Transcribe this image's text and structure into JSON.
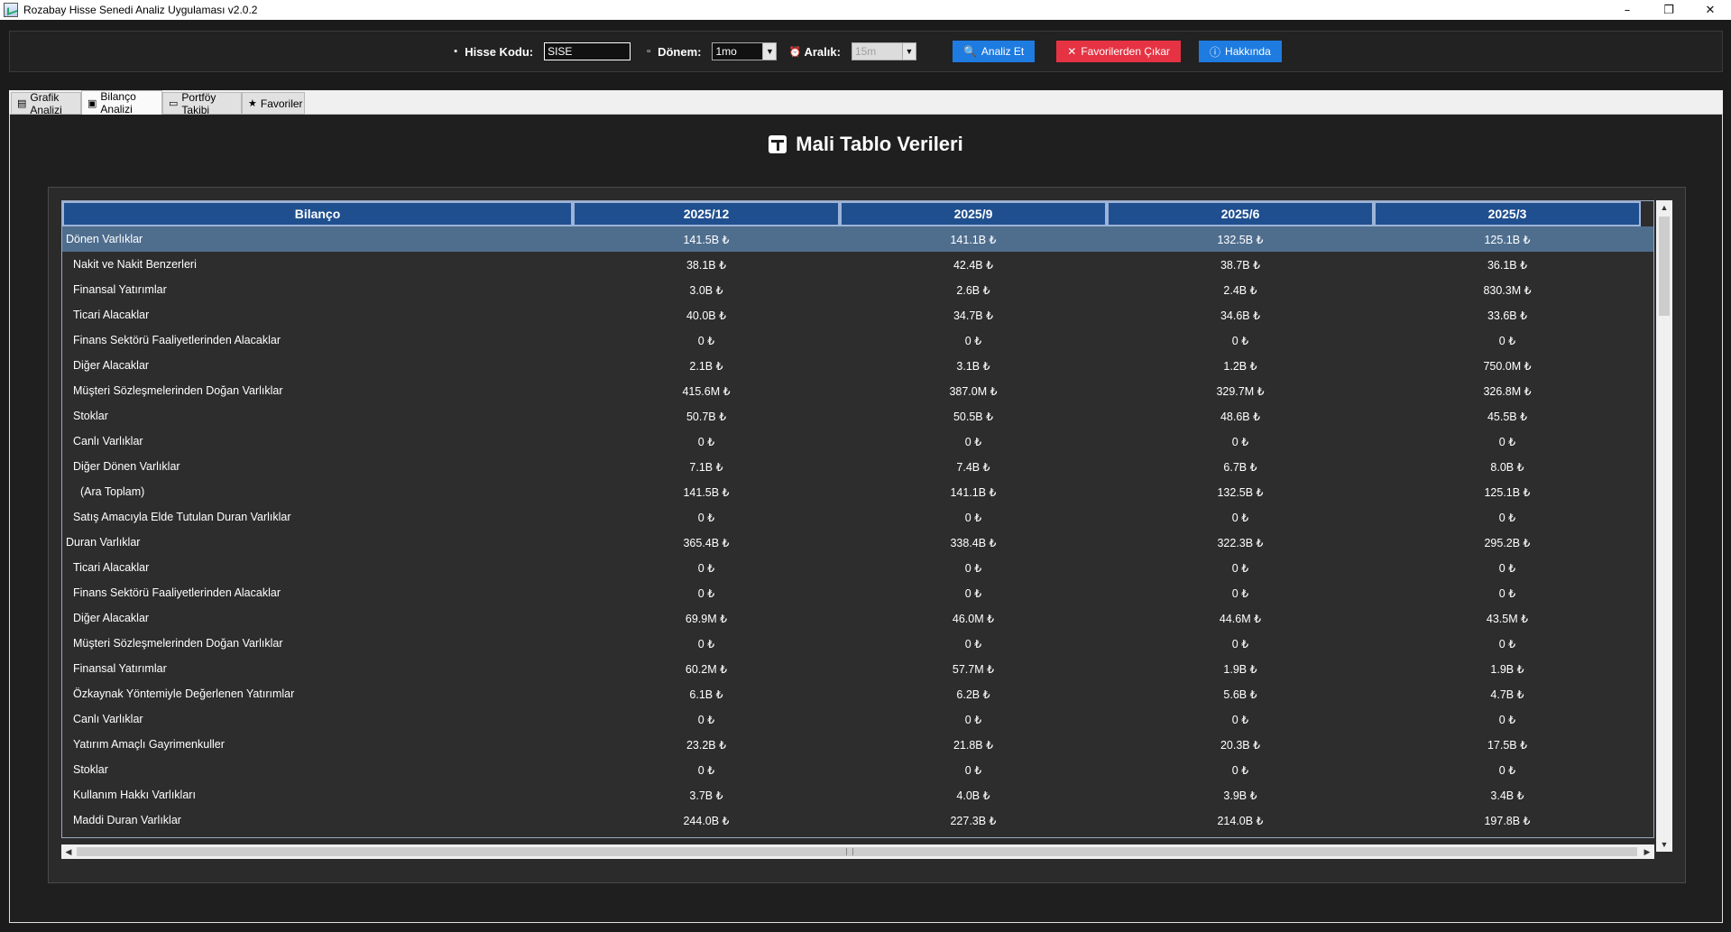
{
  "window": {
    "title": "Rozabay Hisse Senedi Analiz Uygulaması v2.0.2",
    "controls": {
      "minimize": "–",
      "maximize": "❐",
      "close": "✕"
    }
  },
  "toolbar": {
    "symbol_label": "Hisse Kodu:",
    "symbol_value": "SISE",
    "period_label": "Dönem:",
    "period_value": "1mo",
    "interval_label": "Aralık:",
    "interval_value": "15m",
    "analyze_label": "Analiz Et",
    "remove_fav_label": "Favorilerden Çıkar",
    "about_label": "Hakkında"
  },
  "tabs": [
    {
      "label": "Grafik Analizi",
      "active": false
    },
    {
      "label": "Bilanço Analizi",
      "active": true
    },
    {
      "label": "Portföy Takibi",
      "active": false
    },
    {
      "label": "Favoriler",
      "active": false
    }
  ],
  "page": {
    "title": "Mali Tablo Verileri"
  },
  "table": {
    "headers": [
      "Bilanço",
      "2025/12",
      "2025/9",
      "2025/6",
      "2025/3"
    ],
    "rows": [
      {
        "label": "Dönen Varlıklar",
        "level": 0,
        "selected": true,
        "values": [
          "141.5B ₺",
          "141.1B ₺",
          "132.5B ₺",
          "125.1B ₺"
        ]
      },
      {
        "label": "Nakit ve Nakit Benzerleri",
        "level": 1,
        "values": [
          "38.1B ₺",
          "42.4B ₺",
          "38.7B ₺",
          "36.1B ₺"
        ]
      },
      {
        "label": "Finansal Yatırımlar",
        "level": 1,
        "values": [
          "3.0B ₺",
          "2.6B ₺",
          "2.4B ₺",
          "830.3M ₺"
        ]
      },
      {
        "label": "Ticari Alacaklar",
        "level": 1,
        "values": [
          "40.0B ₺",
          "34.7B ₺",
          "34.6B ₺",
          "33.6B ₺"
        ]
      },
      {
        "label": "Finans Sektörü Faaliyetlerinden Alacaklar",
        "level": 1,
        "values": [
          "0 ₺",
          "0 ₺",
          "0 ₺",
          "0 ₺"
        ]
      },
      {
        "label": "Diğer Alacaklar",
        "level": 1,
        "values": [
          "2.1B ₺",
          "3.1B ₺",
          "1.2B ₺",
          "750.0M ₺"
        ]
      },
      {
        "label": "Müşteri Sözleşmelerinden Doğan Varlıklar",
        "level": 1,
        "values": [
          "415.6M ₺",
          "387.0M ₺",
          "329.7M ₺",
          "326.8M ₺"
        ]
      },
      {
        "label": "Stoklar",
        "level": 1,
        "values": [
          "50.7B ₺",
          "50.5B ₺",
          "48.6B ₺",
          "45.5B ₺"
        ]
      },
      {
        "label": "Canlı Varlıklar",
        "level": 1,
        "values": [
          "0 ₺",
          "0 ₺",
          "0 ₺",
          "0 ₺"
        ]
      },
      {
        "label": "Diğer Dönen Varlıklar",
        "level": 1,
        "values": [
          "7.1B ₺",
          "7.4B ₺",
          "6.7B ₺",
          "8.0B ₺"
        ]
      },
      {
        "label": "(Ara Toplam)",
        "level": 2,
        "values": [
          "141.5B ₺",
          "141.1B ₺",
          "132.5B ₺",
          "125.1B ₺"
        ]
      },
      {
        "label": "Satış Amacıyla Elde Tutulan Duran Varlıklar",
        "level": 1,
        "values": [
          "0 ₺",
          "0 ₺",
          "0 ₺",
          "0 ₺"
        ]
      },
      {
        "label": "Duran Varlıklar",
        "level": 0,
        "values": [
          "365.4B ₺",
          "338.4B ₺",
          "322.3B ₺",
          "295.2B ₺"
        ]
      },
      {
        "label": "Ticari Alacaklar",
        "level": 1,
        "values": [
          "0 ₺",
          "0 ₺",
          "0 ₺",
          "0 ₺"
        ]
      },
      {
        "label": "Finans Sektörü Faaliyetlerinden Alacaklar",
        "level": 1,
        "values": [
          "0 ₺",
          "0 ₺",
          "0 ₺",
          "0 ₺"
        ]
      },
      {
        "label": "Diğer Alacaklar",
        "level": 1,
        "values": [
          "69.9M ₺",
          "46.0M ₺",
          "44.6M ₺",
          "43.5M ₺"
        ]
      },
      {
        "label": "Müşteri Sözleşmelerinden Doğan Varlıklar",
        "level": 1,
        "values": [
          "0 ₺",
          "0 ₺",
          "0 ₺",
          "0 ₺"
        ]
      },
      {
        "label": "Finansal Yatırımlar",
        "level": 1,
        "values": [
          "60.2M ₺",
          "57.7M ₺",
          "1.9B ₺",
          "1.9B ₺"
        ]
      },
      {
        "label": "Özkaynak Yöntemiyle Değerlenen Yatırımlar",
        "level": 1,
        "values": [
          "6.1B ₺",
          "6.2B ₺",
          "5.6B ₺",
          "4.7B ₺"
        ]
      },
      {
        "label": "Canlı Varlıklar",
        "level": 1,
        "values": [
          "0 ₺",
          "0 ₺",
          "0 ₺",
          "0 ₺"
        ]
      },
      {
        "label": "Yatırım Amaçlı Gayrimenkuller",
        "level": 1,
        "values": [
          "23.2B ₺",
          "21.8B ₺",
          "20.3B ₺",
          "17.5B ₺"
        ]
      },
      {
        "label": "Stoklar",
        "level": 1,
        "values": [
          "0 ₺",
          "0 ₺",
          "0 ₺",
          "0 ₺"
        ]
      },
      {
        "label": "Kullanım Hakkı Varlıkları",
        "level": 1,
        "values": [
          "3.7B ₺",
          "4.0B ₺",
          "3.9B ₺",
          "3.4B ₺"
        ]
      },
      {
        "label": "Maddi Duran Varlıklar",
        "level": 1,
        "values": [
          "244.0B ₺",
          "227.3B ₺",
          "214.0B ₺",
          "197.8B ₺"
        ]
      }
    ]
  }
}
